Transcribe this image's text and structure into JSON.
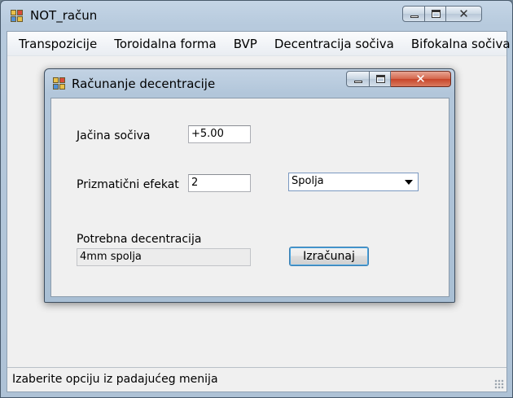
{
  "main_window": {
    "title": "NOT_račun",
    "menu": [
      "Transpozicije",
      "Toroidalna forma",
      "BVP",
      "Decentracija sočiva",
      "Bifokalna sočiva"
    ],
    "status": "Izaberite opciju iz padajućeg menija"
  },
  "dialog": {
    "title": "Računanje decentracije",
    "lens_power_label": "Jačina sočiva",
    "lens_power_value": "+5.00",
    "prism_label": "Prizmatični efekat",
    "prism_value": "2",
    "direction_selected": "Spolja",
    "result_label": "Potrebna decentracija",
    "result_value": "4mm spolja",
    "calculate_label": "Izračunaj"
  },
  "icons": {
    "app_icon": "windows-forms-app-icon",
    "minimize": "minimize-icon",
    "maximize": "maximize-icon",
    "close": "close-icon",
    "dropdown": "chevron-down-icon"
  }
}
